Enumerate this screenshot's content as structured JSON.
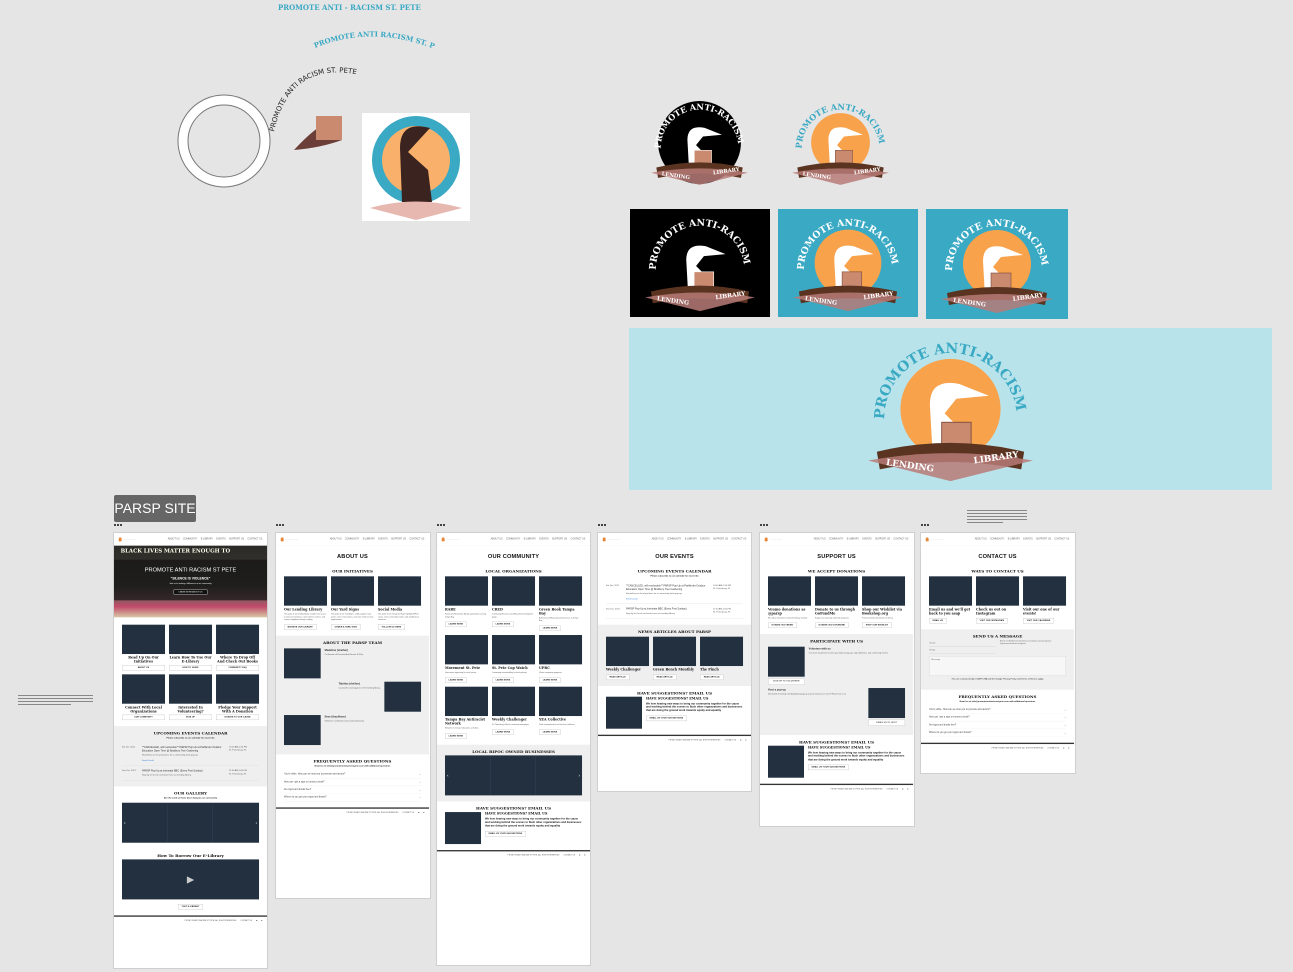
{
  "canvas": {
    "curve_texts": [
      "PROMOTE  ANTI - RACISM  ST. PETE",
      "PROMOTE ANTI RACISM ST. PETE",
      "PROMOTE  ANTI RACISM  ST. PETE"
    ],
    "logo_text": {
      "arc": "PROMOTE ANTI-RACISM ST. PETE",
      "left": "LENDING",
      "right": "LIBRARY"
    },
    "section_label": "PARSP SITE",
    "colors": {
      "teal": "#3aa9c4",
      "orange": "#f8a24b",
      "banner_bg": "#b9e3ea",
      "dark_card": "#22303f",
      "brown": "#5a3420"
    }
  },
  "site": {
    "nav": [
      "ABOUT US",
      "COMMUNITY",
      "E-LIBRARY",
      "EVENTS",
      "SUPPORT US",
      "CONTACT US"
    ],
    "footer": {
      "copyright": "PROMOTE ANTI RACISM ST PETE, ALL RIGHTS RESERVED",
      "link": "CONTACT US"
    }
  },
  "pages": [
    {
      "name": "home",
      "hero": {
        "top": "BLACK LIVES MATTER  ENOUGH TO",
        "title": "PROMOTE ANTI RACISM ST PETE",
        "quote": "\"SILENCE IS VIOLENCE\"",
        "subtitle": "Join us in making a difference in our community",
        "button": "LEARN MORE ABOUT US"
      },
      "sections": [
        {
          "type": "cards",
          "center": true,
          "cards": [
            {
              "title": "Read Up On Our Initiatives",
              "button": "ABOUT US"
            },
            {
              "title": "Learn How To Use Our E-Library",
              "button": "HOW TO GUIDE"
            },
            {
              "title": "Where To Drop Off And Check Out Books",
              "button": "COMMUNITY FAQ"
            },
            {
              "title": "Connect With Local Organizations",
              "button": "OUR COMMUNITY"
            },
            {
              "title": "Interested In Volunteering?",
              "button": "SIGN UP"
            },
            {
              "title": "Pledge Your Support With A Donation",
              "button": "DONATE TO OUR CAUSE"
            }
          ]
        },
        {
          "type": "events",
          "gray": true,
          "heading": "UPCOMING EVENTS CALENDAR",
          "sub": "Please subscribe to our calendar for more info",
          "link": "Event Details",
          "events": [
            {
              "date": "Sat Dec 2021",
              "title": "**CANCELLED, will reschedule** PARSP Pop-Up at Pathfinder Outdoor Education Open Time @ Bradbury Tree Gardening",
              "desc": "Hosted by our local partners for a community book pop-up.",
              "time": "10:00 AM-1:00 PM",
              "place": "St. Petersburg, FL"
            },
            {
              "date": "Sun Dec 2021",
              "title": "PARSP Pop-Up at Interstate BBC (Every First Sunday)",
              "desc": "Stop by to check out books from our lending library.",
              "time": "11:00 AM-1:00 PM",
              "place": "St. Petersburg, FL"
            }
          ]
        },
        {
          "type": "carousel",
          "heading": "OUR GALLERY",
          "sub": "See the work we have been doing in our community"
        },
        {
          "type": "video",
          "heading": "How To Borrow Our E-Library",
          "button": "VISIT E-LIBRARY"
        }
      ]
    },
    {
      "name": "about",
      "title": "ABOUT US",
      "sections": [
        {
          "type": "cards",
          "heading": "OUR INITIATIVES",
          "cards": [
            {
              "title": "Our Lending Library",
              "text": "The goals of our lending library: provide free access to anti-racist literature, center diverse authors, and connect neighbors through reading.",
              "button": "BROWSE OUR LIBRARY"
            },
            {
              "title": "Our Yard Signs",
              "text": "The goals of our Yard Signs: visibly support racial justice, start conversations, and raise funds for local organizations.",
              "button": "ORDER A YARD SIGN"
            },
            {
              "title": "Social Media",
              "text": "The goals of our Instagram Page: highlight BIPOC voices, share community events, and amplify local resources.",
              "button": "FOLLOW US HERE"
            }
          ]
        },
        {
          "type": "team",
          "gray": true,
          "heading": "ABOUT THE PARSP TEAM",
          "members": [
            {
              "name": "Madeline (she/her)",
              "text": "Co-founder of Promote Anti Racism St Pete."
            },
            {
              "name": "Tabitha (she/her)",
              "text": "Co-founder and organizer of the lending library."
            },
            {
              "name": "Bree (they/them)",
              "text": "Volunteer coordinator and community liaison."
            }
          ]
        },
        {
          "type": "faq",
          "heading": "FREQUENTLY ASKED QUESTIONS",
          "sub": "Email us at info@promoteantiracismstpete.com with additional questions",
          "questions": [
            "You're white. How can we trust you to promote anti-racism?",
            "How can I get a sign or borrow a book?",
            "Are signs and books free?",
            "Where do you get your signs and books?"
          ]
        }
      ]
    },
    {
      "name": "community",
      "title": "OUR COMMUNITY",
      "sections": [
        {
          "type": "cards",
          "heading": "LOCAL ORGANIZATIONS",
          "cards": [
            {
              "title": "RARE",
              "text": "Racial and Restorative Equity organization serving Tampa Bay.",
              "button": "LEARN MORE"
            },
            {
              "title": "CRED",
              "text": "Community Resource and Education Development group.",
              "button": "LEARN MORE"
            },
            {
              "title": "Green Book Tampa Bay",
              "text": "A directory of Black-owned businesses in Tampa Bay.",
              "button": "LEARN MORE"
            },
            {
              "title": "Movement St. Pete",
              "text": "Grassroots organizing for racial justice.",
              "button": "LEARN MORE"
            },
            {
              "title": "St. Pete Cop Watch",
              "text": "Community accountability for local policing.",
              "button": "LEARN MORE"
            },
            {
              "title": "UPRC",
              "text": "Uhuru community programs.",
              "button": "LEARN MORE"
            },
            {
              "title": "Tampa Bay Antiracist Network",
              "text": "Network of antiracist educators and allies.",
              "button": "LEARN MORE"
            },
            {
              "title": "Weekly Challenger",
              "text": "St. Petersburg's Black community newspaper.",
              "button": "LEARN MORE"
            },
            {
              "title": "YEA Collective",
              "text": "Youth empowerment and activism collective.",
              "button": "LEARN MORE"
            }
          ]
        },
        {
          "type": "carousel",
          "gray": true,
          "heading": "LOCAL BIPOC OWNED BUSINESSES"
        },
        {
          "type": "feature",
          "heading": "HAVE SUGGESTIONS? EMAIL US",
          "text": "We love hearing new ways to bring our community together for the cause and working behind the scenes to flush other organizations and businesses that are doing the ground work towards equity and equality",
          "button": "EMAIL US YOUR SUGGESTIONS"
        }
      ]
    },
    {
      "name": "events",
      "title": "OUR EVENTS",
      "sections": [
        {
          "type": "events",
          "heading": "UPCOMING EVENTS CALENDAR",
          "sub": "Please subscribe to our calendar for more info",
          "link": "Event Details",
          "events": [
            {
              "date": "Sat Dec 2021",
              "title": "**CANCELLED, will reschedule** PARSP Pop-Up at Pathfinder Outdoor Education Open Time @ Bradbury Tree Gardening",
              "desc": "Hosted by our local partners for a community book pop-up.",
              "time": "10:00 AM-1:00 PM",
              "place": "St. Petersburg, FL"
            },
            {
              "date": "Sun Dec 2021",
              "title": "PARSP Pop-Up at Interstate BBC (Every First Sunday)",
              "desc": "Stop by to check out books from our lending library.",
              "time": "11:00 AM-1:00 PM",
              "place": "St. Petersburg, FL"
            }
          ]
        },
        {
          "type": "cards",
          "gray": true,
          "heading": "NEWS ARTICLES ABOUT PARSP",
          "cards": [
            {
              "title": "Weekly Challenger",
              "button": "READ ARTICLE"
            },
            {
              "title": "Green Bench Monthly",
              "button": "READ ARTICLE"
            },
            {
              "title": "The Pinch",
              "button": "READ ARTICLE"
            }
          ]
        },
        {
          "type": "feature",
          "heading": "HAVE SUGGESTIONS? EMAIL US",
          "text": "We love hearing new ways to bring our community together for the cause and working behind the scenes to flush other organizations and businesses that are doing the ground work towards equity and equality",
          "button": "EMAIL US YOUR SUGGESTIONS"
        }
      ]
    },
    {
      "name": "support",
      "title": "SUPPORT US",
      "sections": [
        {
          "type": "cards",
          "heading": "WE ACCEPT DONATIONS",
          "cards": [
            {
              "title": "Venmo donations as @parsp",
              "text": "We rely on donations to keep the library stocked.",
              "button": "DONATE VIA VENMO"
            },
            {
              "title": "Donate to us through GoFundMe",
              "text": "Support our yard sign and book programs.",
              "button": "DONATE VIA GOFUNDME"
            },
            {
              "title": "Shop our Wishlist via Bookshop.org",
              "text": "Purchase books directly for our library.",
              "button": "SHOP OUR WISHLIST"
            }
          ]
        },
        {
          "type": "participate",
          "gray": true,
          "heading": "PARTICIPATE WITH US",
          "a": {
            "title": "Volunteer with us",
            "text": "Our team would love to have your help at pop-ups, sign deliveries, and community events.",
            "button": "SIGN UP TO VOLUNTEER"
          },
          "b": {
            "title": "Host a pop-up",
            "text": "Interested in hosting a lending library pop-up at your business or event? Reach out to us.",
            "button": "EMAIL US TO HOST"
          }
        },
        {
          "type": "feature",
          "heading": "HAVE SUGGESTIONS? EMAIL US",
          "text": "We love hearing new ways to bring our community together for the cause and working behind the scenes to flush other organizations and businesses that are doing the ground work towards equity and equality",
          "button": "EMAIL US YOUR SUGGESTIONS"
        }
      ]
    },
    {
      "name": "contact",
      "title": "CONTACT US",
      "sections": [
        {
          "type": "cards",
          "heading": "WAYS TO CONTACT US",
          "cards": [
            {
              "title": "Email us and we'll get back to you asap",
              "button": "EMAIL US"
            },
            {
              "title": "Check us out on Instagram",
              "button": "VISIT OUR INSTAGRAM"
            },
            {
              "title": "Visit our one of our events!",
              "button": "VISIT OUR CALENDAR"
            }
          ]
        },
        {
          "type": "contactform",
          "gray": true,
          "heading": "SEND US A MESSAGE",
          "name": "Name",
          "email": "Email",
          "message": "Message",
          "info": "Email: hello@promoteantiracismstpete.org  Instagram: @promoteantiracismstpete",
          "captcha": "This site is protected by reCAPTCHA and the Google Privacy Policy and Terms of Service apply."
        },
        {
          "type": "faq",
          "heading": "FREQUENTLY ASKED QUESTIONS",
          "sub": "Email us at info@promoteantiracismstpete.com with additional questions",
          "questions": [
            "You're white. How can we trust you to promote anti-racism?",
            "How can I get a sign or borrow a book?",
            "Are signs and books free?",
            "Where do you get your signs and books?"
          ]
        }
      ]
    }
  ]
}
